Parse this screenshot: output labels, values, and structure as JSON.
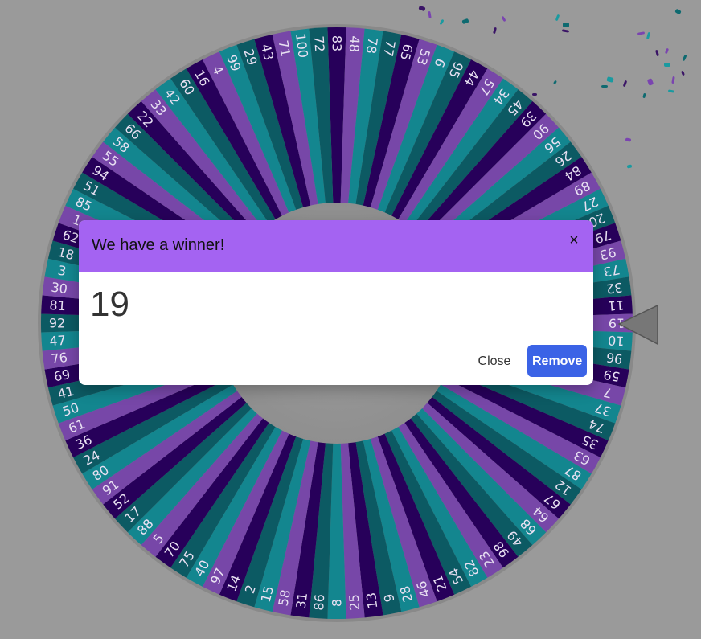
{
  "wheel": {
    "segments_clockwise_from_top": [
      "83",
      "48",
      "78",
      "77",
      "65",
      "53",
      "6",
      "95",
      "44",
      "57",
      "34",
      "45",
      "39",
      "90",
      "56",
      "26",
      "84",
      "89",
      "27",
      "20",
      "79",
      "93",
      "73",
      "32",
      "11",
      "19",
      "10",
      "96",
      "59",
      "7",
      "37",
      "74",
      "35",
      "63",
      "87",
      "12",
      "67",
      "64",
      "68",
      "49",
      "98",
      "23",
      "82",
      "54",
      "21",
      "46",
      "28",
      "9",
      "13",
      "25",
      "8",
      "86",
      "31",
      "58",
      "15",
      "2",
      "14",
      "97",
      "40",
      "75",
      "70",
      "5",
      "88",
      "17",
      "52",
      "91",
      "80",
      "24",
      "36",
      "61",
      "50",
      "41",
      "69",
      "76",
      "47",
      "92",
      "81",
      "30",
      "3",
      "18",
      "62",
      "1",
      "85",
      "51",
      "94",
      "55",
      "58",
      "66",
      "22",
      "33",
      "42",
      "60",
      "16",
      "4",
      "99",
      "29",
      "43",
      "71",
      "100",
      "72"
    ],
    "colors": [
      "#27005a",
      "#7747a8",
      "#13868f",
      "#0c5a63"
    ],
    "pointer_color": "#777777"
  },
  "confetti_colors": [
    "#3a1466",
    "#7a44b0",
    "#1a9aa0",
    "#0e6a70"
  ],
  "modal": {
    "title": "We have a winner!",
    "close_icon": "×",
    "result": "19",
    "close_label": "Close",
    "remove_label": "Remove",
    "header_color": "#a463f2",
    "remove_color": "#3b63e6"
  }
}
